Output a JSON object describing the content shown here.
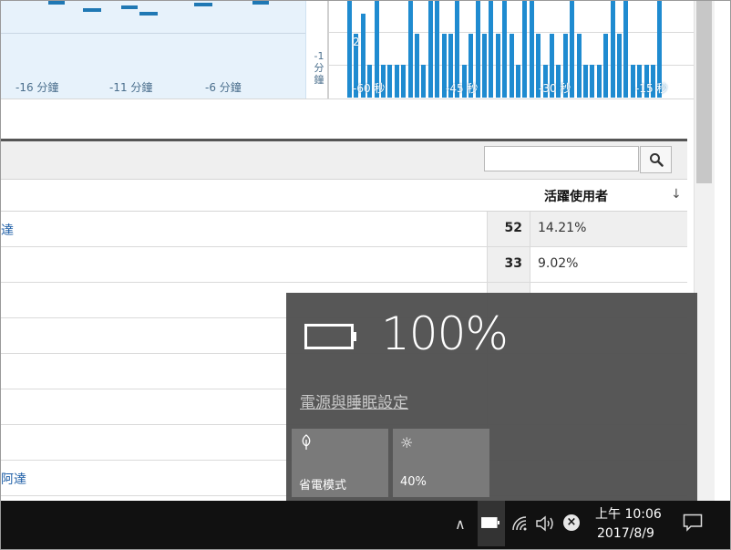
{
  "charts": {
    "minute_ticks": [
      "-16 分鐘",
      "-11 分鐘",
      "-6 分鐘"
    ],
    "minute_edge_label": "-1\n分\n鐘",
    "second_ticks": [
      "-60 秒",
      "-45 秒",
      "-30 秒",
      "-15 秒"
    ],
    "second_value_label": "2"
  },
  "table": {
    "column_header": "活躍使用者",
    "rows": [
      {
        "name": "達",
        "count": "52",
        "percent": "14.21%"
      },
      {
        "name": "",
        "count": "33",
        "percent": "9.02%"
      },
      {
        "name": "",
        "count": "",
        "percent": ""
      },
      {
        "name": "",
        "count": "",
        "percent": ""
      },
      {
        "name": "",
        "count": "",
        "percent": ""
      },
      {
        "name": "",
        "count": "",
        "percent": ""
      },
      {
        "name": "",
        "count": "",
        "percent": ""
      },
      {
        "name": "阿達",
        "count": "",
        "percent": ""
      }
    ]
  },
  "battery_flyout": {
    "percent": "100%",
    "settings_link": "電源與睡眠設定",
    "tiles": [
      {
        "label": "省電模式",
        "icon": "leaf-icon"
      },
      {
        "label": "40%",
        "icon": "brightness-icon"
      }
    ]
  },
  "taskbar": {
    "time": "上午 10:06",
    "date": "2017/8/9"
  },
  "colors": {
    "chart_blue": "#1f8bd0",
    "link_blue": "#1f5fa7",
    "flyout_bg": "#505050",
    "taskbar_bg": "#111111"
  }
}
